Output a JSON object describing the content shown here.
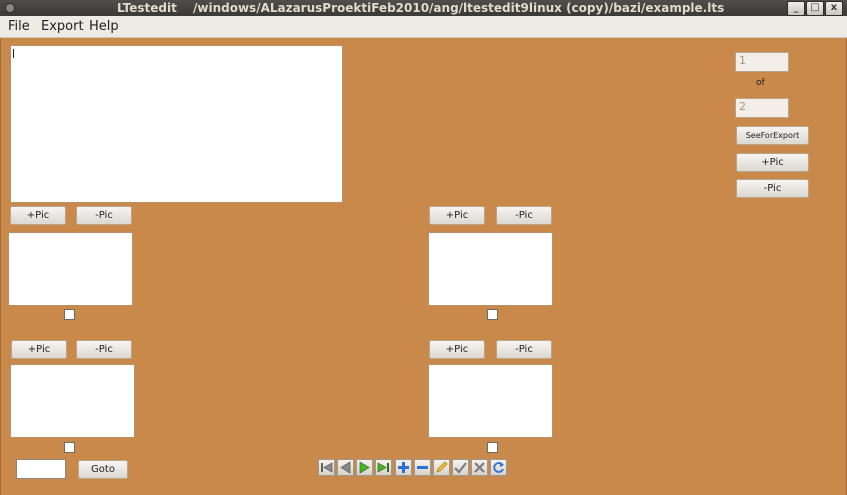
{
  "window": {
    "app_title": "LTestedit",
    "path_title": "/windows/ALazarusProektiFeb2010/ang/ltestedit9linux (copy)/bazi/example.lts",
    "minimize": "_",
    "maximize": "□",
    "close": "x"
  },
  "menu": {
    "file": "File",
    "export": "Export",
    "help": "Help"
  },
  "right_panel": {
    "current_value": "1",
    "of_label": "of",
    "total_value": "2",
    "see_for_export": "SeeForExport",
    "add_pic": "+Pic",
    "remove_pic": "-Pic"
  },
  "pic_groups": [
    {
      "add": "+Pic",
      "remove": "-Pic"
    },
    {
      "add": "+Pic",
      "remove": "-Pic"
    },
    {
      "add": "+Pic",
      "remove": "-Pic"
    },
    {
      "add": "+Pic",
      "remove": "-Pic"
    }
  ],
  "goto": {
    "input_value": "",
    "button_label": "Goto"
  },
  "navigator": {
    "buttons": [
      "first-icon",
      "prior-icon",
      "next-icon",
      "last-icon",
      "insert-icon",
      "delete-icon",
      "edit-icon",
      "post-icon",
      "cancel-icon",
      "refresh-icon"
    ]
  },
  "colors": {
    "background": "#c8894a",
    "panel": "#ffffff",
    "titlebar": "#3c3b37"
  }
}
